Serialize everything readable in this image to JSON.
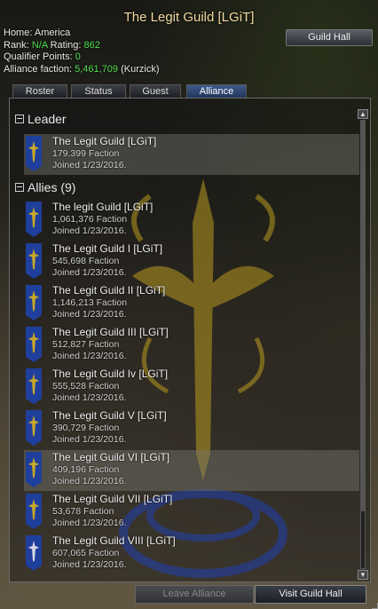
{
  "window": {
    "title": "The Legit Guild [LGiT]",
    "hall_button": "Guild Hall"
  },
  "info": {
    "home_label": "Home:",
    "home_value": "America",
    "rank_label": "Rank:",
    "rank_value": "N/A",
    "rating_label": "Rating:",
    "rating_value": "862",
    "qual_label": "Qualifier Points:",
    "qual_value": "0",
    "faction_label": "Alliance faction:",
    "faction_value": "5,461,709",
    "faction_side": "(Kurzick)"
  },
  "tabs": [
    {
      "label": "Roster"
    },
    {
      "label": "Status"
    },
    {
      "label": "Guest"
    },
    {
      "label": "Alliance",
      "active": true
    }
  ],
  "leader_section": "Leader",
  "allies_section": "Allies (9)",
  "leader": {
    "name": "The Legit Guild [LGiT]",
    "faction": "179,399 Faction",
    "joined": "Joined 1/23/2016."
  },
  "allies": [
    {
      "name": "The legit Guild [LGiT]",
      "faction": "1,061,376 Faction",
      "joined": "Joined 1/23/2016."
    },
    {
      "name": "The Legit Guild I [LGiT]",
      "faction": "545,698 Faction",
      "joined": "Joined 1/23/2016."
    },
    {
      "name": "The Legit Guild II [LGiT]",
      "faction": "1,146,213 Faction",
      "joined": "Joined 1/23/2016."
    },
    {
      "name": "The Legit Guild III [LGiT]",
      "faction": "512,827 Faction",
      "joined": "Joined 1/23/2016."
    },
    {
      "name": "The Legit Guild Iv [LGiT]",
      "faction": "555,528 Faction",
      "joined": "Joined 1/23/2016."
    },
    {
      "name": "The Legit Guild V [LGiT]",
      "faction": "390,729 Faction",
      "joined": "Joined 1/23/2016."
    },
    {
      "name": "The Legit Guild VI [LGiT]",
      "faction": "409,196 Faction",
      "joined": "Joined 1/23/2016."
    },
    {
      "name": "The Legit Guild VII [LGiT]",
      "faction": "53,678 Faction",
      "joined": "Joined 1/23/2016."
    },
    {
      "name": "The Legit Guild VIII [LGiT]",
      "faction": "607,065 Faction",
      "joined": "Joined 1/23/2016."
    }
  ],
  "buttons": {
    "leave": "Leave Alliance",
    "visit": "Visit Guild Hall"
  },
  "colors": {
    "banner_blue": "#1f3f9c",
    "emblem_gold": "#c8a828",
    "positive_green": "#4fe04f"
  },
  "icons": {
    "banner": "guild-banner-icon",
    "collapse": "collapse-minus-icon",
    "scroll_up": "scroll-up-arrow-icon",
    "scroll_down": "scroll-down-arrow-icon"
  }
}
